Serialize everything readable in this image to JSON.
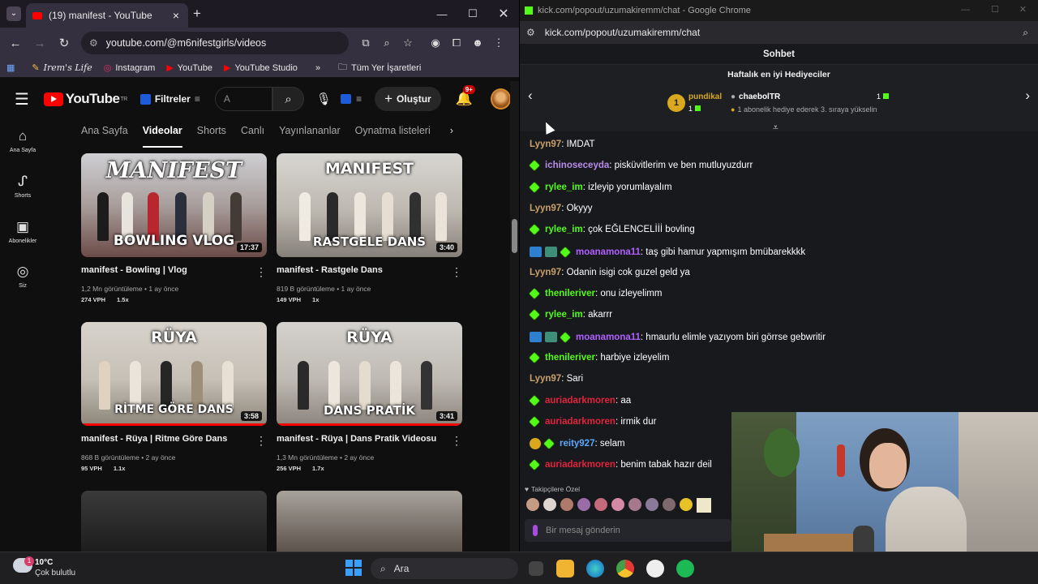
{
  "youtube_window": {
    "tab_title": "(19) manifest - YouTube",
    "url": "youtube.com/@m6nifestgirls/videos",
    "bookmarks": [
      "Irem's Life",
      "Instagram",
      "YouTube",
      "YouTube Studio",
      "Tüm Yer İşaretleri"
    ],
    "header": {
      "logo_text": "YouTube",
      "logo_region": "TR",
      "filters_label": "Filtreler",
      "search_placeholder": "A",
      "create_label": "Oluştur",
      "notif_count": "9+"
    },
    "rail": [
      {
        "label": "Ana Sayfa"
      },
      {
        "label": "Shorts"
      },
      {
        "label": "Abonelikler"
      },
      {
        "label": "Siz"
      }
    ],
    "channel_tabs": [
      "Ana Sayfa",
      "Videolar",
      "Shorts",
      "Canlı",
      "Yayınlananlar",
      "Oynatma listeleri"
    ],
    "active_tab": "Videolar",
    "videos": [
      {
        "thumb_text": "MANIFEST",
        "thumb_sub": "BOWLING VLOG",
        "duration": "17:37",
        "title": "manifest - Bowling | Vlog",
        "views": "1,2 Mn görüntüleme",
        "age": "1 ay önce",
        "vph": "274 VPH",
        "ratio": "1.5x"
      },
      {
        "thumb_text": "MANIFEST",
        "thumb_sub": "RASTGELE DANS",
        "duration": "3:40",
        "title": "manifest - Rastgele Dans",
        "views": "819 B görüntüleme",
        "age": "1 ay önce",
        "vph": "149 VPH",
        "ratio": "1x"
      },
      {
        "thumb_text": "RÜYA",
        "thumb_sub": "RİTME GÖRE DANS",
        "duration": "3:58",
        "title": "manifest - Rüya | Ritme Göre Dans",
        "views": "868 B görüntüleme",
        "age": "2 ay önce",
        "vph": "95 VPH",
        "ratio": "1.1x"
      },
      {
        "thumb_text": "RÜYA",
        "thumb_sub": "DANS PRATİK",
        "duration": "3:41",
        "title": "manifest - Rüya | Dans Pratik Videosu",
        "views": "1,3 Mn görüntüleme",
        "age": "2 ay önce",
        "vph": "256 VPH",
        "ratio": "1.7x"
      }
    ]
  },
  "kick_window": {
    "window_title": "kick.com/popout/uzumakiremm/chat - Google Chrome",
    "url": "kick.com/popout/uzumakiremm/chat",
    "header": "Sohbet",
    "gifters_title": "Haftalık en iyi Hediyeciler",
    "top_gifter": {
      "rank": "1",
      "name": "pundikal",
      "count": "1"
    },
    "second": {
      "name": "chaebolTR",
      "count": "1",
      "note": "1 abonelik hediye ederek 3. sıraya yükselin"
    },
    "messages": [
      {
        "user": "Lyyn97",
        "color": "#c8a06a",
        "text": ": IMDAT",
        "gem": false,
        "badges": false,
        "sub": false
      },
      {
        "user": "ichinoseceyda",
        "color": "#b98ce8",
        "text": ": pisküvitlerim ve ben mutluyuzdurr",
        "gem": true,
        "badges": false,
        "sub": false
      },
      {
        "user": "rylee_im",
        "color": "#53fc18",
        "text": ": izleyip yorumlayalım",
        "gem": true,
        "badges": false,
        "sub": false
      },
      {
        "user": "Lyyn97",
        "color": "#c8a06a",
        "text": ": Okyyy",
        "gem": false,
        "badges": false,
        "sub": false
      },
      {
        "user": "rylee_im",
        "color": "#53fc18",
        "text": ": çok EĞLENCELİİİ bovling",
        "gem": true,
        "badges": false,
        "sub": false
      },
      {
        "user": "moanamona11",
        "color": "#b060ff",
        "text": ": taş gibi hamur yapmışım bmübarekkkk",
        "gem": true,
        "badges": true,
        "sub": false
      },
      {
        "user": "Lyyn97",
        "color": "#c8a06a",
        "text": ": Odanin isigi cok guzel geld ya",
        "gem": false,
        "badges": false,
        "sub": false
      },
      {
        "user": "thenileriver",
        "color": "#53fc18",
        "text": ": onu izleyelimm",
        "gem": true,
        "badges": false,
        "sub": false
      },
      {
        "user": "rylee_im",
        "color": "#53fc18",
        "text": ": akarrr",
        "gem": true,
        "badges": false,
        "sub": false
      },
      {
        "user": "moanamona11",
        "color": "#b060ff",
        "text": ": hmaurlu elimle yazıyom biri görrse gebwritir",
        "gem": true,
        "badges": true,
        "sub": false
      },
      {
        "user": "thenileriver",
        "color": "#53fc18",
        "text": ": harbiye izleyelim",
        "gem": true,
        "badges": false,
        "sub": false
      },
      {
        "user": "Lyyn97",
        "color": "#c8a06a",
        "text": ": Sari",
        "gem": false,
        "badges": false,
        "sub": false
      },
      {
        "user": "auriadarkmoren",
        "color": "#e0243c",
        "text": ": aa",
        "gem": true,
        "badges": false,
        "sub": false
      },
      {
        "user": "auriadarkmoren",
        "color": "#e0243c",
        "text": ": irmik dur",
        "gem": true,
        "badges": false,
        "sub": false
      },
      {
        "user": "reity927",
        "color": "#5aa9ff",
        "text": ": selam",
        "gem": true,
        "badges": false,
        "sub": true
      },
      {
        "user": "auriadarkmoren",
        "color": "#e0243c",
        "text": ": benim tabak hazır deil",
        "gem": true,
        "badges": false,
        "sub": false
      }
    ],
    "emote_header": "Takipçilere Özel",
    "chat_placeholder": "Bir mesaj gönderin"
  },
  "taskbar": {
    "temp": "10°C",
    "weather": "Çok bulutlu",
    "search_label": "Ara",
    "weather_badge": "1"
  }
}
